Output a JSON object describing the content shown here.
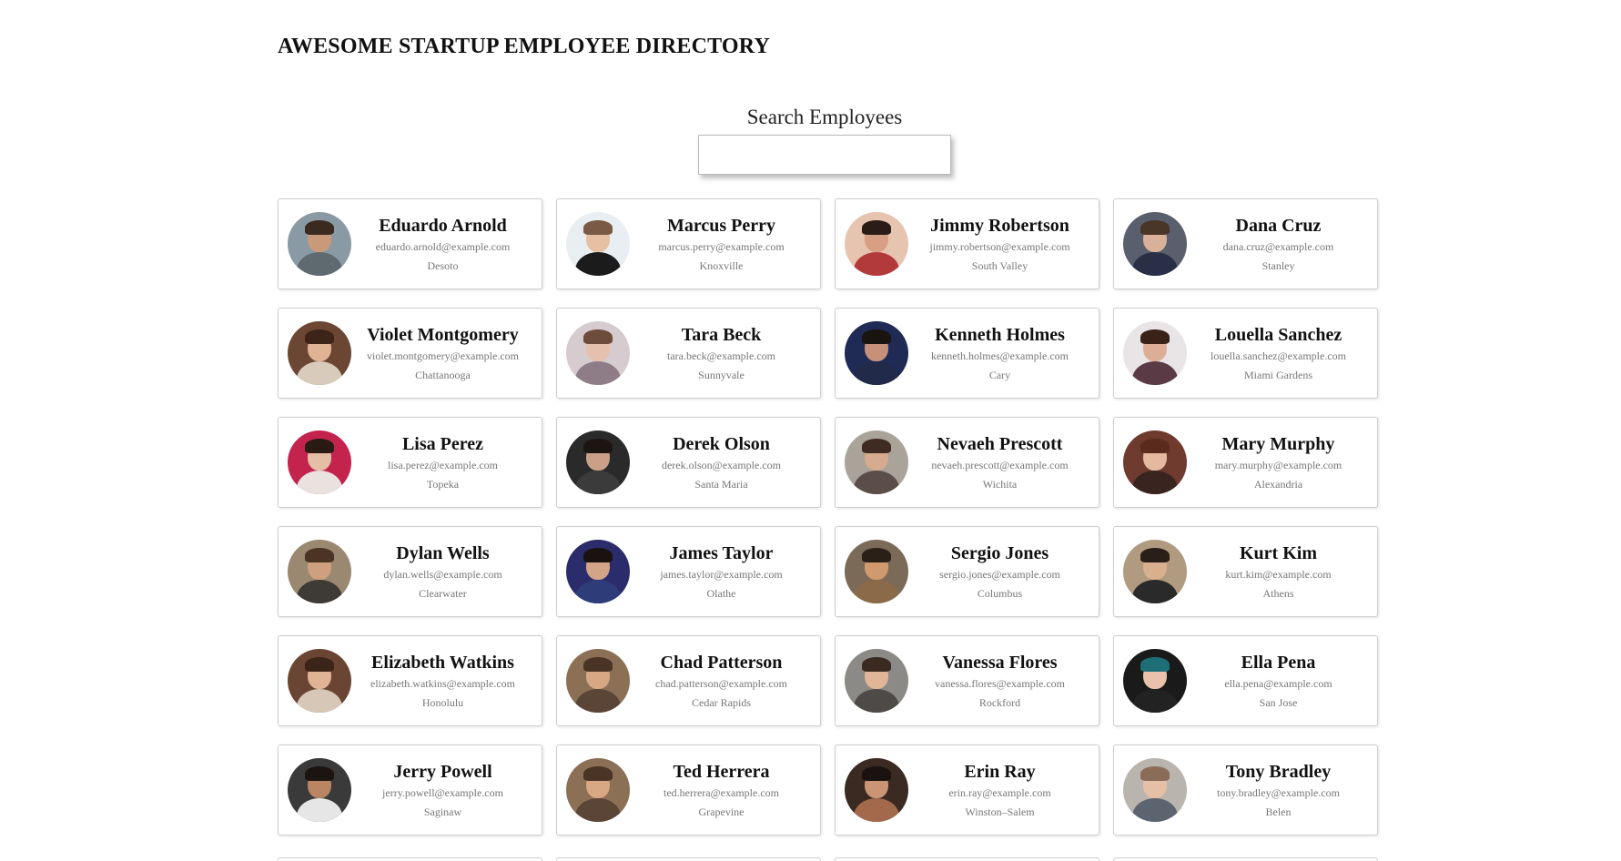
{
  "header": {
    "title": "AWESOME STARTUP EMPLOYEE DIRECTORY"
  },
  "search": {
    "label": "Search Employees",
    "value": "",
    "placeholder": ""
  },
  "employees": [
    {
      "name": "Eduardo Arnold",
      "email": "eduardo.arnold@example.com",
      "city": "Desoto",
      "avatar": {
        "bg": "#8a9aa5",
        "skin": "#c89a7a",
        "hair": "#3b2a20",
        "shirt": "#5e6a70"
      }
    },
    {
      "name": "Marcus Perry",
      "email": "marcus.perry@example.com",
      "city": "Knoxville",
      "avatar": {
        "bg": "#e8eef2",
        "skin": "#e7bfa3",
        "hair": "#7a5a44",
        "shirt": "#1b1b1b"
      }
    },
    {
      "name": "Jimmy Robertson",
      "email": "jimmy.robertson@example.com",
      "city": "South Valley",
      "avatar": {
        "bg": "#e7c4b0",
        "skin": "#d99f84",
        "hair": "#2a1c16",
        "shirt": "#b23a3a"
      }
    },
    {
      "name": "Dana Cruz",
      "email": "dana.cruz@example.com",
      "city": "Stanley",
      "avatar": {
        "bg": "#5a5f6e",
        "skin": "#d9b09a",
        "hair": "#4a3628",
        "shirt": "#2a2f48"
      }
    },
    {
      "name": "Violet Montgomery",
      "email": "violet.montgomery@example.com",
      "city": "Chattanooga",
      "avatar": {
        "bg": "#6b4733",
        "skin": "#e0b395",
        "hair": "#3d2418",
        "shirt": "#d8cbbb"
      }
    },
    {
      "name": "Tara Beck",
      "email": "tara.beck@example.com",
      "city": "Sunnyvale",
      "avatar": {
        "bg": "#d6cccf",
        "skin": "#e5c0ae",
        "hair": "#6e4c3c",
        "shirt": "#8e7d86"
      }
    },
    {
      "name": "Kenneth Holmes",
      "email": "kenneth.holmes@example.com",
      "city": "Cary",
      "avatar": {
        "bg": "#1f2a55",
        "skin": "#c69079",
        "hair": "#1a1411",
        "shirt": "#222a4a"
      }
    },
    {
      "name": "Louella Sanchez",
      "email": "louella.sanchez@example.com",
      "city": "Miami Gardens",
      "avatar": {
        "bg": "#e9e4e6",
        "skin": "#dcae95",
        "hair": "#3a2218",
        "shirt": "#5a3a45"
      }
    },
    {
      "name": "Lisa Perez",
      "email": "lisa.perez@example.com",
      "city": "Topeka",
      "avatar": {
        "bg": "#c4234e",
        "skin": "#e4bfa5",
        "hair": "#2a1a14",
        "shirt": "#e9e2df"
      }
    },
    {
      "name": "Derek Olson",
      "email": "derek.olson@example.com",
      "city": "Santa Maria",
      "avatar": {
        "bg": "#2a2a2a",
        "skin": "#caa088",
        "hair": "#1c1512",
        "shirt": "#3b3b3b"
      }
    },
    {
      "name": "Nevaeh Prescott",
      "email": "nevaeh.prescott@example.com",
      "city": "Wichita",
      "avatar": {
        "bg": "#a9a39a",
        "skin": "#d7ab90",
        "hair": "#3f2b22",
        "shirt": "#5b4d48"
      }
    },
    {
      "name": "Mary Murphy",
      "email": "mary.murphy@example.com",
      "city": "Alexandria",
      "avatar": {
        "bg": "#6e3b2e",
        "skin": "#e5b9a0",
        "hair": "#5a2a1c",
        "shirt": "#3a2420"
      }
    },
    {
      "name": "Dylan Wells",
      "email": "dylan.wells@example.com",
      "city": "Clearwater",
      "avatar": {
        "bg": "#9a8870",
        "skin": "#cfa07f",
        "hair": "#4b3424",
        "shirt": "#3e3a36"
      }
    },
    {
      "name": "James Taylor",
      "email": "james.taylor@example.com",
      "city": "Olathe",
      "avatar": {
        "bg": "#2b2c6b",
        "skin": "#d4a489",
        "hair": "#1a1210",
        "shirt": "#2e3d7a"
      }
    },
    {
      "name": "Sergio Jones",
      "email": "sergio.jones@example.com",
      "city": "Columbus",
      "avatar": {
        "bg": "#7c6a58",
        "skin": "#d09a6e",
        "hair": "#2b2018",
        "shirt": "#8a6a48"
      }
    },
    {
      "name": "Kurt Kim",
      "email": "kurt.kim@example.com",
      "city": "Athens",
      "avatar": {
        "bg": "#b09a80",
        "skin": "#d8b08e",
        "hair": "#2a1e18",
        "shirt": "#2a2a2a"
      }
    },
    {
      "name": "Elizabeth Watkins",
      "email": "elizabeth.watkins@example.com",
      "city": "Honolulu",
      "avatar": {
        "bg": "#6a4534",
        "skin": "#e0b395",
        "hair": "#3b2418",
        "shirt": "#d6c7b6"
      }
    },
    {
      "name": "Chad Patterson",
      "email": "chad.patterson@example.com",
      "city": "Cedar Rapids",
      "avatar": {
        "bg": "#8c7056",
        "skin": "#d8a783",
        "hair": "#4a3426",
        "shirt": "#5a4536"
      }
    },
    {
      "name": "Vanessa Flores",
      "email": "vanessa.flores@example.com",
      "city": "Rockford",
      "avatar": {
        "bg": "#8c8a86",
        "skin": "#e1b598",
        "hair": "#3a2a22",
        "shirt": "#4e4a48"
      }
    },
    {
      "name": "Ella Pena",
      "email": "ella.pena@example.com",
      "city": "San Jose",
      "avatar": {
        "bg": "#1a1a1a",
        "skin": "#e9c2ad",
        "hair": "#1e6e78",
        "shirt": "#222"
      }
    },
    {
      "name": "Jerry Powell",
      "email": "jerry.powell@example.com",
      "city": "Saginaw",
      "avatar": {
        "bg": "#3a3a3a",
        "skin": "#b98562",
        "hair": "#1b1411",
        "shirt": "#e6e6e6"
      }
    },
    {
      "name": "Ted Herrera",
      "email": "ted.herrera@example.com",
      "city": "Grapevine",
      "avatar": {
        "bg": "#8c7056",
        "skin": "#d8a783",
        "hair": "#4a3426",
        "shirt": "#5a4536"
      }
    },
    {
      "name": "Erin Ray",
      "email": "erin.ray@example.com",
      "city": "Winston–Salem",
      "avatar": {
        "bg": "#3a2a22",
        "skin": "#c99575",
        "hair": "#1a1210",
        "shirt": "#a26a4a"
      }
    },
    {
      "name": "Tony Bradley",
      "email": "tony.bradley@example.com",
      "city": "Belen",
      "avatar": {
        "bg": "#b9b4ae",
        "skin": "#e6c0a6",
        "hair": "#8a6c58",
        "shirt": "#5c6470"
      }
    }
  ]
}
